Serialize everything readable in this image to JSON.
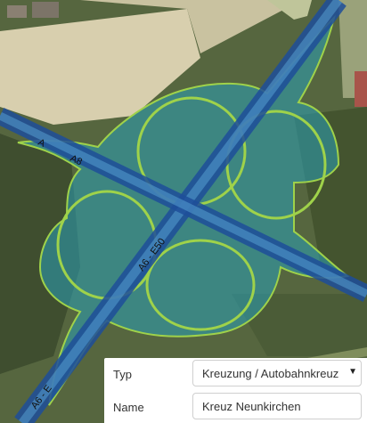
{
  "map": {
    "road_labels": [
      "A",
      "A8",
      "A6 - E50",
      "A6 - E"
    ],
    "colors": {
      "interchange_fill": "#2aa0b8",
      "motorway": "#1d4d9a",
      "ramp_outline": "#9fd24a",
      "field": "#d9cfae",
      "forest": "#4a5a37"
    }
  },
  "form": {
    "type_label": "Typ",
    "type_value": "Kreuzung / Autobahnkreuz",
    "name_label": "Name",
    "name_value": "Kreuz Neunkirchen"
  }
}
